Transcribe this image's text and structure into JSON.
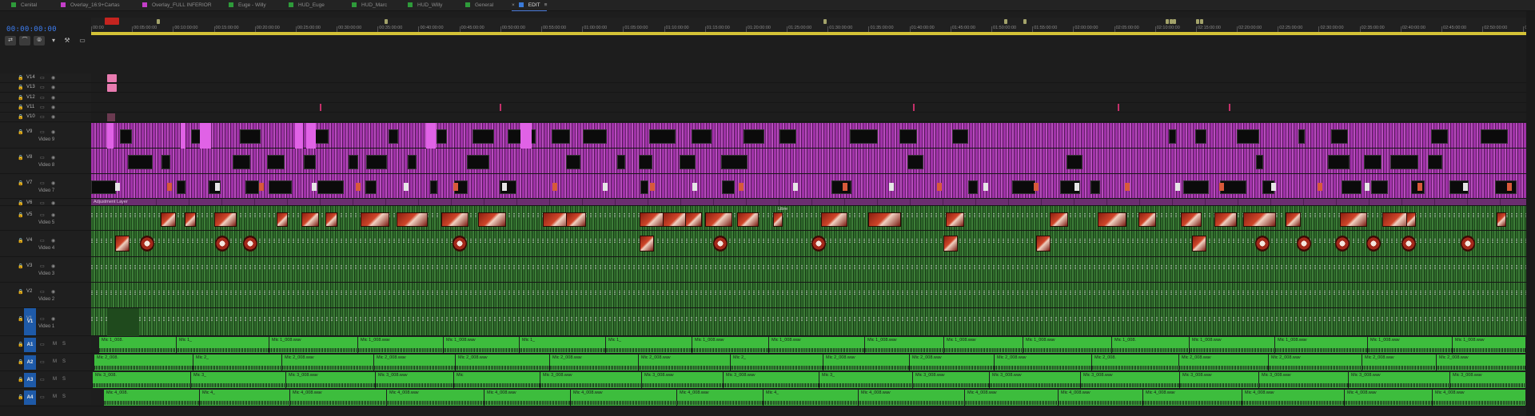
{
  "tabs": [
    {
      "label": "Cenital",
      "color": "#2e9b3a"
    },
    {
      "label": "Overlay_16:9+Cartas",
      "color": "#c43ec9"
    },
    {
      "label": "Overlay_FULL INFERIOR",
      "color": "#c43ec9"
    },
    {
      "label": "Euge - Willy",
      "color": "#2e9b3a"
    },
    {
      "label": "HUD_Euge",
      "color": "#2e9b3a"
    },
    {
      "label": "HUD_Marc",
      "color": "#2e9b3a"
    },
    {
      "label": "HUD_Willy",
      "color": "#2e9b3a"
    },
    {
      "label": "General",
      "color": "#2e9b3a"
    },
    {
      "label": "EDIT",
      "color": "#3a7ad8",
      "active": true,
      "close": "×",
      "menu": "≡"
    }
  ],
  "timecode": "00:00:00:00",
  "tools": {
    "ripple": "⇄",
    "link": "⌒",
    "snap": "⦾",
    "marker": "▾",
    "wrench": "⚒",
    "captions": "▭"
  },
  "ruler": {
    "ticks": [
      "00:00",
      "00:05:00:00",
      "00:10:00:00",
      "00:15:00:00",
      "00:20:00:00",
      "00:25:00:00",
      "00:30:00:00",
      "00:35:00:00",
      "00:40:00:00",
      "00:45:00:00",
      "00:50:00:00",
      "00:55:00:00",
      "01:00:00:00",
      "01:05:00:00",
      "01:10:00:00",
      "01:15:00:00",
      "01:20:00:00",
      "01:25:00:00",
      "01:30:00:00",
      "01:35:00:00",
      "01:40:00:00",
      "01:45:00:00",
      "01:50:00:00",
      "01:55:00:00",
      "02:00:00:00",
      "02:05:00:00",
      "02:10:00:00",
      "02:15:00:00",
      "02:20:00:00",
      "02:25:00:00",
      "02:30:00:00",
      "02:35:00:00",
      "02:40:00:00",
      "02:45:00:00",
      "02:50:00:00",
      "02:55:00"
    ]
  },
  "video_tracks": [
    {
      "id": "V14",
      "name": "",
      "type": "empty"
    },
    {
      "id": "V13",
      "name": "",
      "type": "empty"
    },
    {
      "id": "V12",
      "name": "",
      "type": "empty"
    },
    {
      "id": "V11",
      "name": "",
      "type": "empty"
    },
    {
      "id": "V10",
      "name": "",
      "type": "empty"
    },
    {
      "id": "V9",
      "name": "Video 9",
      "type": "purple"
    },
    {
      "id": "V8",
      "name": "Video 8",
      "type": "purple"
    },
    {
      "id": "V7",
      "name": "Video 7",
      "type": "purple"
    },
    {
      "id": "V6",
      "name": "",
      "type": "adjust",
      "label": "Adjustment Layer"
    },
    {
      "id": "V5",
      "name": "Video 5",
      "type": "green",
      "label": "Libre"
    },
    {
      "id": "V4",
      "name": "Video 4",
      "type": "green"
    },
    {
      "id": "V3",
      "name": "Video 3",
      "type": "green"
    },
    {
      "id": "V2",
      "name": "Video 2",
      "type": "green"
    },
    {
      "id": "V1",
      "name": "Video 1",
      "type": "green",
      "source": "V1"
    }
  ],
  "audio_tracks": [
    {
      "id": "A1",
      "clips": [
        "Mic 1_008.",
        "Mic 1_",
        "Mic 1_008.wav",
        "Mic 1_008.wav",
        "Mic 1_008.wav",
        "Mic 1_",
        "Mic 1_",
        "Mic 1_008.wav",
        "Mic 1_008.wav",
        "Mic 1_008.wav",
        "Mic 1_008.wav",
        "Mic 1_008.wav",
        "Mic 1_008.",
        "Mic 1_008.wav",
        "Mic 1_008.wav",
        "Mic 1_008.wav",
        "Mic 1_008.wav"
      ]
    },
    {
      "id": "A2",
      "clips": [
        "Mic 2_008.",
        "Mic 2_",
        "Mic 2_008.wav",
        "Mic 2_008.wav",
        "Mic 2_008.wav",
        "Mic 2_008.wav",
        "Mic 2_008.wav",
        "Mic 2_",
        "Mic 2_008.wav",
        "Mic 2_008.wav",
        "Mic 2_008.wav",
        "Mic 2_008.",
        "Mic 2_008.wav",
        "Mic 2_008.wav",
        "Mic 2_008.wav",
        "Mic 2_008.wav"
      ]
    },
    {
      "id": "A3",
      "clips": [
        "Mic 3_008.",
        "Mic 3_",
        "Mic 3_008.wav",
        "Mic 3_008.wav",
        "Mic",
        "Mic 3_008.wav",
        "Mic 3_008.wav",
        "Mic 3_008.wav",
        "Mic 3_",
        "Mic 3_008.wav",
        "Mic 3_008.wav",
        "Mic 3_008.wav",
        "Mic 3_008.wav",
        "Mic 3_008.wav",
        "Mic 3_008.wav",
        "Mic 3_008.wav"
      ]
    },
    {
      "id": "A4",
      "clips": [
        "Mic 4_008.",
        "Mic 4_",
        "Mic 4_008.wav",
        "Mic 4_008.wav",
        "Mic 4_008.wav",
        "Mic 4_008.wav",
        "Mic 4_008.wav",
        "Mic 4_",
        "Mic 4_008.wav",
        "Mic 4_008.wav",
        "Mic 4_008.wav",
        "Mic 4_008.wav",
        "Mic 4_008.wav",
        "Mic 4_008.wav",
        "Mic 4_008.wav"
      ]
    }
  ],
  "track_controls": {
    "lock": "🔒",
    "sync": "▭",
    "eye": "◉",
    "mute": "M",
    "solo": "S"
  },
  "colors": {
    "purple": "#a032a8",
    "green": "#2f6a2b",
    "audio": "#3dbd3d",
    "accent": "#3d7df0",
    "playhead": "#c5241f",
    "workarea": "#d4c237"
  }
}
